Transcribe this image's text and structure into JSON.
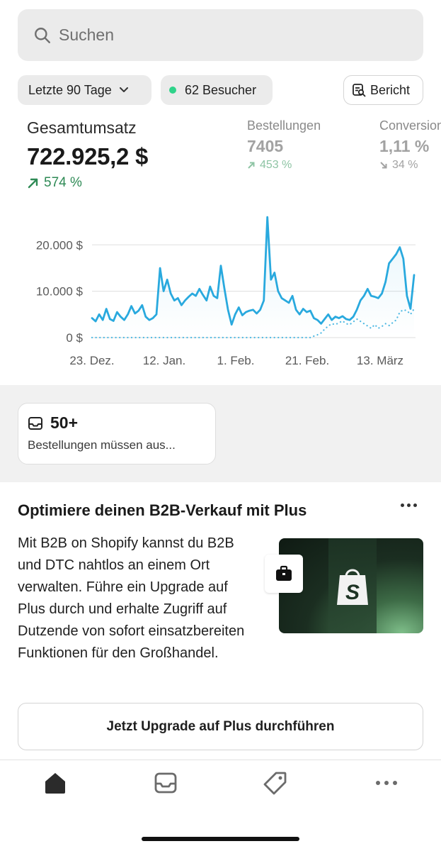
{
  "search": {
    "placeholder": "Suchen"
  },
  "filters": {
    "range_label": "Letzte 90 Tage",
    "visitors_label": "62 Besucher",
    "report_label": "Bericht"
  },
  "metrics": {
    "main": {
      "title": "Gesamtumsatz",
      "value": "722.925,2 $",
      "change": "574 %"
    },
    "orders": {
      "title": "Bestellungen",
      "value": "7405",
      "change": "453 %"
    },
    "conversion": {
      "title": "Conversion",
      "value": "1,11 %",
      "change": "34 %"
    }
  },
  "chart_data": {
    "type": "line",
    "x_tick_labels": [
      "23. Dez.",
      "12. Jan.",
      "1. Feb.",
      "21. Feb.",
      "13. März"
    ],
    "y_tick_labels": [
      "20.000 $",
      "10.000 $",
      "0 $"
    ],
    "ylim": [
      0,
      28000
    ],
    "grid": true,
    "series": [
      {
        "style": "solid",
        "color": "#29a9de",
        "values": [
          4200,
          3500,
          5000,
          3800,
          6200,
          4000,
          3600,
          5500,
          4500,
          3800,
          5000,
          6800,
          5200,
          5800,
          7000,
          4500,
          3800,
          4200,
          5000,
          15000,
          10000,
          12500,
          9500,
          8000,
          8500,
          7000,
          8000,
          8800,
          9500,
          9000,
          10500,
          9200,
          8000,
          11000,
          9000,
          8500,
          15500,
          10500,
          6000,
          2800,
          5000,
          6500,
          4800,
          5500,
          5800,
          6000,
          5200,
          6000,
          8000,
          26000,
          12500,
          14000,
          10000,
          8500,
          8000,
          7500,
          9000,
          6000,
          5000,
          6200,
          5500,
          5800,
          4200,
          3800,
          3000,
          4000,
          5000,
          3800,
          4500,
          4200,
          4600,
          4000,
          3800,
          4500,
          6000,
          8000,
          9000,
          10500,
          9000,
          8800,
          8500,
          9500,
          12000,
          16000,
          17000,
          18000,
          19500,
          17000,
          9000,
          6200,
          13500
        ]
      },
      {
        "style": "dotted",
        "color": "#4fb9e3",
        "values": [
          0,
          0,
          0,
          0,
          0,
          0,
          0,
          0,
          0,
          0,
          0,
          0,
          0,
          0,
          0,
          0,
          0,
          0,
          0,
          0,
          0,
          0,
          0,
          0,
          0,
          0,
          0,
          0,
          0,
          0,
          0,
          0,
          0,
          0,
          0,
          0,
          0,
          0,
          0,
          0,
          0,
          0,
          0,
          0,
          0,
          0,
          0,
          0,
          0,
          0,
          0,
          0,
          0,
          0,
          0,
          0,
          0,
          0,
          0,
          0,
          0,
          0,
          300,
          600,
          1000,
          1800,
          2500,
          3000,
          2800,
          3200,
          3600,
          3000,
          2800,
          3400,
          4000,
          3500,
          3000,
          2500,
          2000,
          2800,
          2000,
          2400,
          3000,
          2600,
          3200,
          3800,
          5500,
          6000,
          5800,
          5000,
          6200
        ]
      }
    ]
  },
  "inbox_card": {
    "count": "50+",
    "label": "Bestellungen müssen aus..."
  },
  "promo": {
    "title": "Optimiere deinen B2B-Verkauf mit Plus",
    "body": "Mit B2B on Shopify kannst du B2B und DTC nahtlos an einem Ort verwalten. Führe ein Upgrade auf Plus durch und erhalte Zugriff auf Dutzende von sofort einsatzbereiten Funktionen für den Großhandel.",
    "cta": "Jetzt Upgrade auf Plus durchführen"
  },
  "icons": [
    "search-icon",
    "chevron-down-icon",
    "report-icon",
    "arrow-up-right-icon",
    "arrow-down-right-icon",
    "inbox-icon",
    "more-icon",
    "briefcase-icon",
    "shopify-bag-icon",
    "home-icon",
    "orders-icon",
    "tag-icon"
  ],
  "colors": {
    "accent_line": "#29a9de",
    "positive": "#2e8a55",
    "status_dot": "#2fd38a"
  }
}
